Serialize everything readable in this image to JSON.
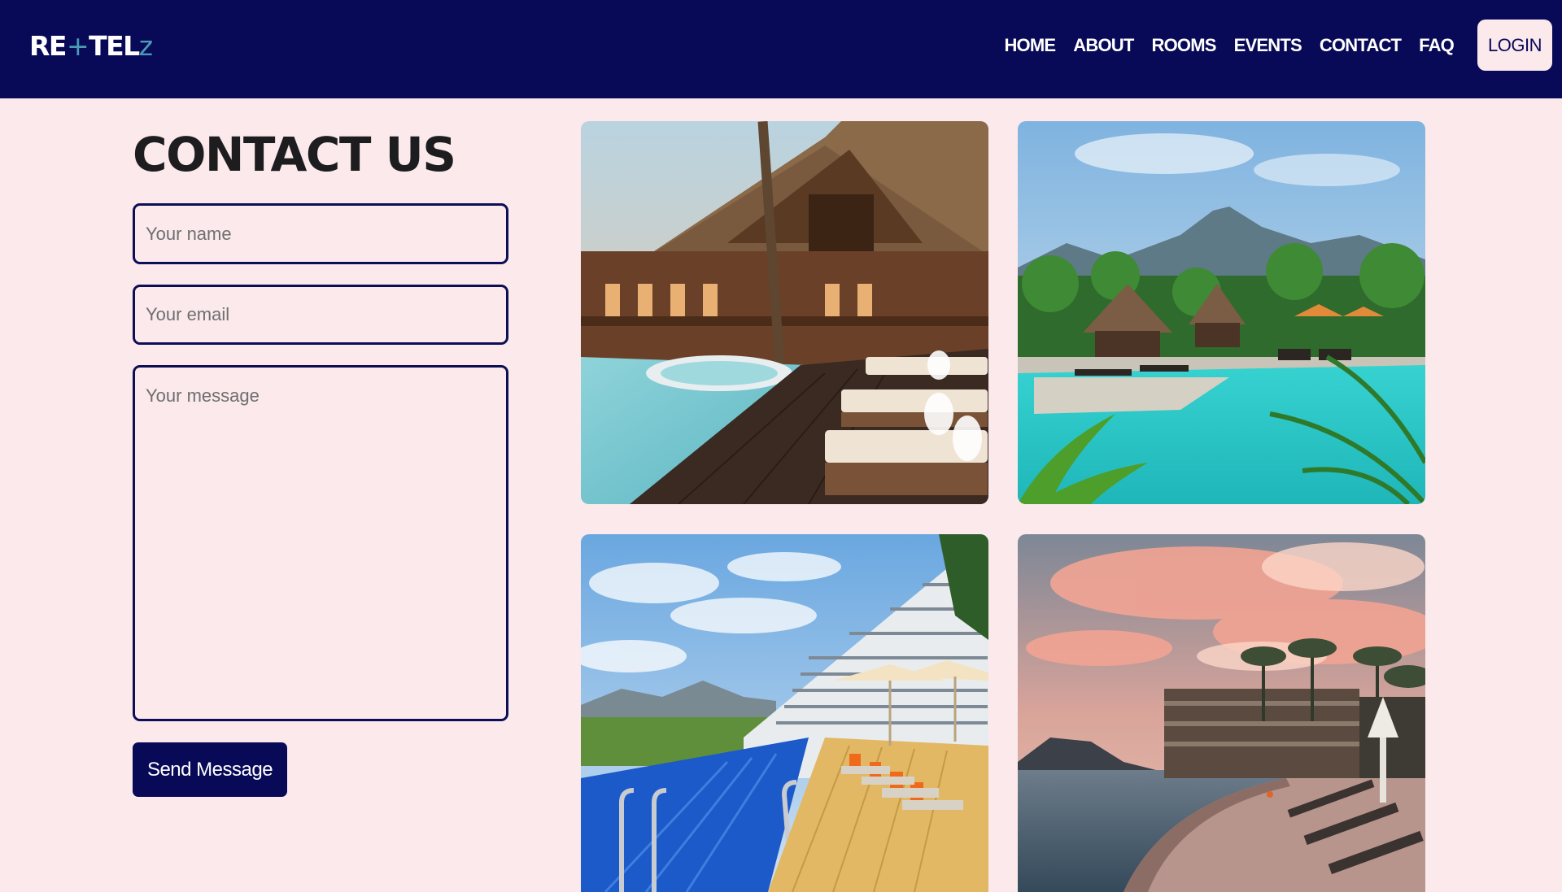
{
  "nav": {
    "logo_main": "RE",
    "logo_plus": "+",
    "logo_tel": "TEL",
    "logo_z": "z",
    "links": [
      "HOME",
      "ABOUT",
      "ROOMS",
      "EVENTS",
      "CONTACT",
      "FAQ"
    ],
    "login_label": "LOGIN"
  },
  "contact": {
    "title": "CONTACT US",
    "name_placeholder": "Your name",
    "email_placeholder": "Your email",
    "message_placeholder": "Your message",
    "send_label": "Send Message"
  },
  "colors": {
    "navbar": "#080a57",
    "page_background": "#fbe9ec",
    "accent": "#4a9bb8",
    "field_border": "#0c0f55"
  }
}
